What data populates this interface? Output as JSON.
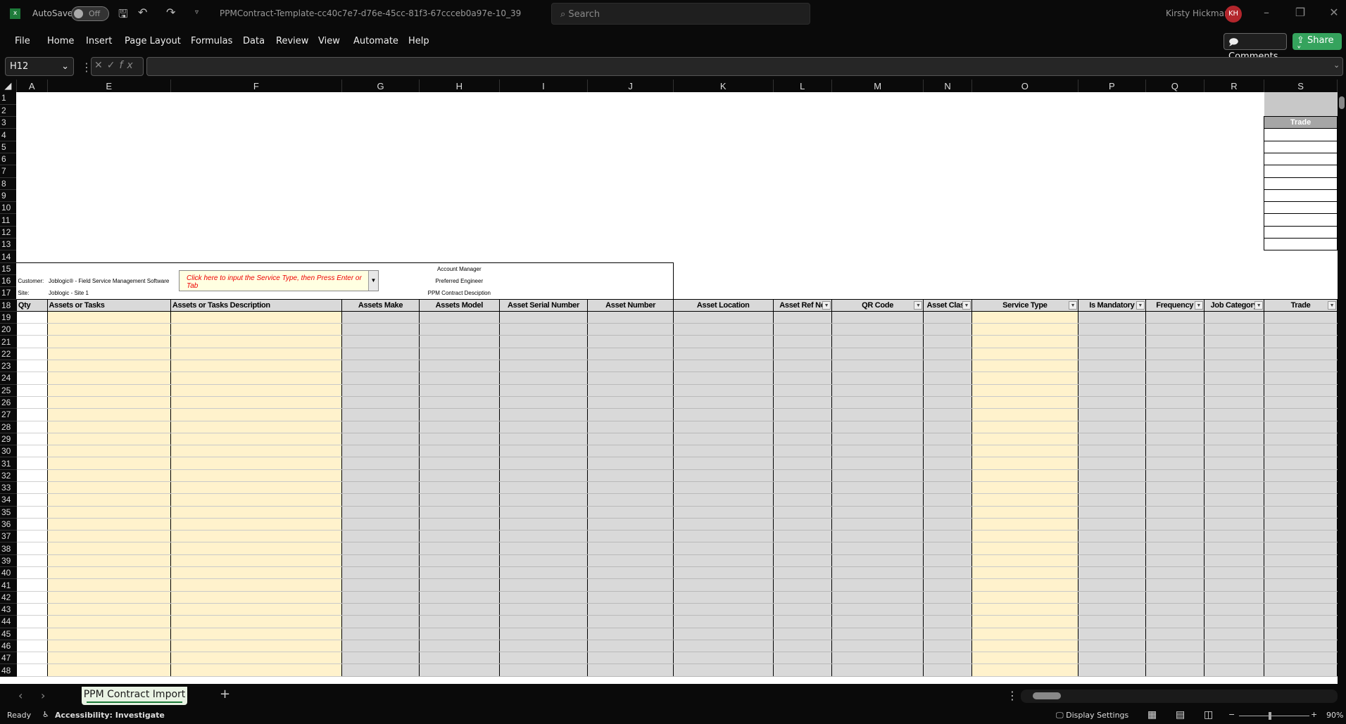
{
  "titlebar": {
    "app_icon": "excel-icon",
    "autosave_label": "AutoSave",
    "autosave_state": "Off",
    "filename": "PPMContract-Template-cc40c7e7-d76e-45cc-81f3-67ccceb0a97e-10_39",
    "search_placeholder": "Search",
    "user_name": "Kirsty Hickman",
    "user_initials": "KH"
  },
  "menu": [
    "File",
    "Home",
    "Insert",
    "Page Layout",
    "Formulas",
    "Data",
    "Review",
    "View",
    "Automate",
    "Help"
  ],
  "buttons": {
    "comments": "Comments",
    "share": "Share"
  },
  "formula_bar": {
    "name_box": "H12",
    "value": ""
  },
  "columns": [
    "A",
    "E",
    "F",
    "G",
    "H",
    "I",
    "J",
    "K",
    "L",
    "M",
    "N",
    "O",
    "P",
    "Q",
    "R",
    "S"
  ],
  "row_numbers": [
    1,
    2,
    3,
    4,
    5,
    6,
    7,
    8,
    9,
    10,
    11,
    12,
    13,
    14,
    15,
    16,
    17,
    18,
    19,
    20,
    21,
    22,
    23,
    24,
    25,
    26,
    27,
    28,
    29,
    30,
    31,
    32,
    33,
    34,
    35,
    36,
    37,
    38,
    39,
    40,
    41,
    42,
    43,
    44,
    45,
    46,
    47,
    48
  ],
  "sheet": {
    "trade_header": "Trade",
    "customer_label": "Customer:",
    "customer_value": "Joblogic® - Field Service Management Software",
    "site_label": "Site:",
    "site_value": "Joblogic - Site 1",
    "service_type_prompt": "Click here to input the Service Type, then Press Enter or Tab",
    "account_manager": "Account Manager",
    "preferred_engineer": "Preferred Engineer",
    "ppm_description": "PPM Contract Desciption",
    "headers": [
      "Qty",
      "Assets or Tasks",
      "Assets or Tasks Description",
      "Assets Make",
      "Assets Model",
      "Asset Serial Number",
      "Asset Number",
      "Asset Location",
      "Asset Ref No",
      "QR Code",
      "Asset Class",
      "Service Type",
      "Is Mandatory",
      "Frequency",
      "Job Category",
      "Trade"
    ]
  },
  "sheet_tabs": [
    {
      "label": "PPM Contract Import",
      "active": true
    }
  ],
  "status": {
    "ready": "Ready",
    "accessibility": "Accessibility: Investigate",
    "display_settings": "Display Settings",
    "zoom": "90%"
  },
  "colors": {
    "input_fill": "#fff2cc",
    "locked_fill": "#d9d9d9",
    "accent": "#35a35d",
    "avatar": "#b3262c"
  }
}
